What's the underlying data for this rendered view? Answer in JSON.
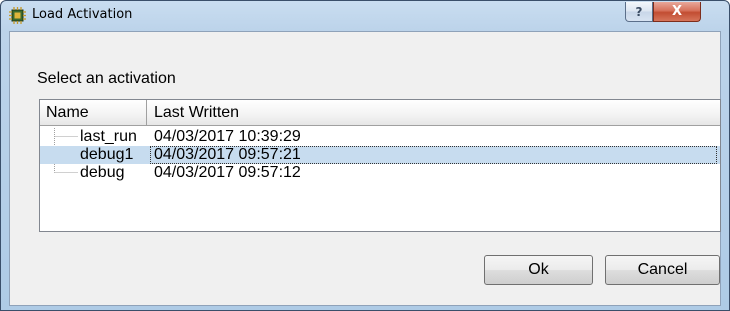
{
  "window": {
    "title": "Load Activation",
    "help_label": "?",
    "close_label": "X"
  },
  "prompt": "Select an activation",
  "table": {
    "columns": [
      "Name",
      "Last Written"
    ],
    "rows": [
      {
        "name": "last_run",
        "last_written": "04/03/2017 10:39:29",
        "selected": false
      },
      {
        "name": "debug1",
        "last_written": "04/03/2017 09:57:21",
        "selected": true
      },
      {
        "name": "debug",
        "last_written": "04/03/2017 09:57:12",
        "selected": false
      }
    ]
  },
  "buttons": {
    "ok": "Ok",
    "cancel": "Cancel"
  },
  "colors": {
    "selection": "#c7dcef",
    "close_button": "#c24d32",
    "dialog_background": "#f0f0f0"
  },
  "icons": {
    "title": "chip-icon"
  }
}
